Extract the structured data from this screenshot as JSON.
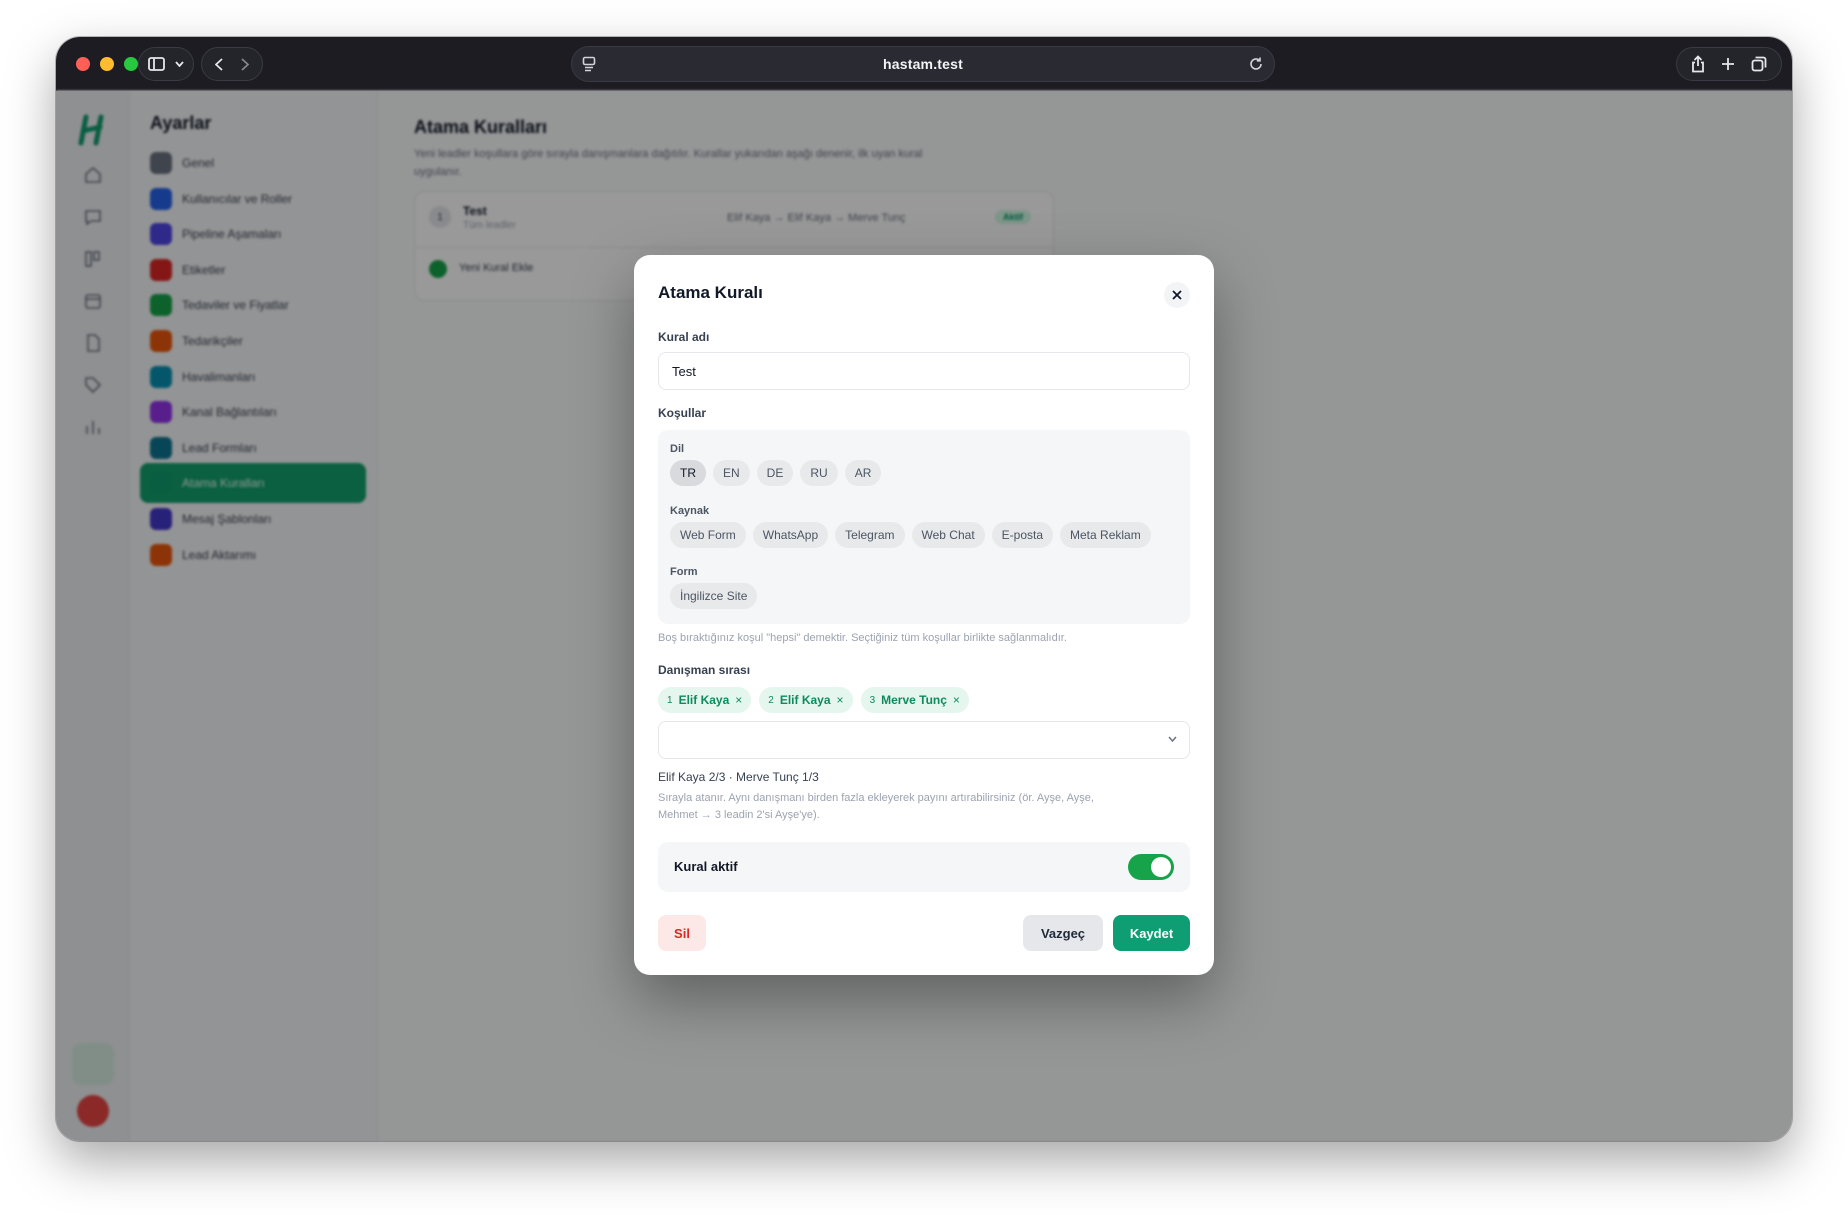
{
  "browser": {
    "url": "hastam.test"
  },
  "sidebar": {
    "title": "Ayarlar",
    "items": [
      {
        "label": "Genel",
        "color": "#6b7280"
      },
      {
        "label": "Kullanıcılar ve Roller",
        "color": "#2563eb"
      },
      {
        "label": "Pipeline Aşamaları",
        "color": "#4f46e5"
      },
      {
        "label": "Etiketler",
        "color": "#dc2626"
      },
      {
        "label": "Tedaviler ve Fiyatlar",
        "color": "#16a34a"
      },
      {
        "label": "Tedarikçiler",
        "color": "#ea580c"
      },
      {
        "label": "Havalimanları",
        "color": "#0891b2"
      },
      {
        "label": "Kanal Bağlantıları",
        "color": "#9333ea"
      },
      {
        "label": "Lead Formları",
        "color": "#0e7490"
      },
      {
        "label": "Atama Kuralları",
        "color": "#0f9d6e",
        "active": true
      },
      {
        "label": "Mesaj Şablonları",
        "color": "#4338ca"
      },
      {
        "label": "Lead Aktarımı",
        "color": "#ea580c"
      }
    ]
  },
  "page": {
    "title": "Atama Kuralları",
    "description": "Yeni leadler koşullara göre sırayla danışmanlara dağıtılır. Kurallar yukarıdan aşağı denenir, ilk uyan kural uygulanır.",
    "rule": {
      "index": "1",
      "name": "Test",
      "subtitle": "Tüm leadler",
      "chain": "Elif Kaya → Elif Kaya → Merve Tunç",
      "badge": "Aktif"
    },
    "add_rule_label": "Yeni Kural Ekle"
  },
  "modal": {
    "title": "Atama Kuralı",
    "rule_name_label": "Kural adı",
    "rule_name_value": "Test",
    "conditions_label": "Koşullar",
    "language_label": "Dil",
    "languages": [
      {
        "label": "TR",
        "selected": true
      },
      {
        "label": "EN",
        "selected": false
      },
      {
        "label": "DE",
        "selected": false
      },
      {
        "label": "RU",
        "selected": false
      },
      {
        "label": "AR",
        "selected": false
      }
    ],
    "source_label": "Kaynak",
    "sources": [
      "Web Form",
      "WhatsApp",
      "Telegram",
      "Web Chat",
      "E-posta",
      "Meta Reklam"
    ],
    "form_label": "Form",
    "forms": [
      "İngilizce Site"
    ],
    "conditions_hint": "Boş bıraktığınız koşul \"hepsi\" demektir. Seçtiğiniz tüm koşullar birlikte sağlanmalıdır.",
    "agent_order_label": "Danışman sırası",
    "agents": [
      {
        "num": "1",
        "name": "Elif Kaya"
      },
      {
        "num": "2",
        "name": "Elif Kaya"
      },
      {
        "num": "3",
        "name": "Merve Tunç"
      }
    ],
    "remove_glyph": "×",
    "distribution": "Elif Kaya 2/3 · Merve Tunç 1/3",
    "agents_hint": "Sırayla atanır. Aynı danışmanı birden fazla ekleyerek payını artırabilirsiniz (ör. Ayşe, Ayşe, Mehmet → 3 leadin 2'si Ayşe'ye).",
    "active_label": "Kural aktif",
    "active_value": true,
    "delete_label": "Sil",
    "cancel_label": "Vazgeç",
    "save_label": "Kaydet"
  }
}
